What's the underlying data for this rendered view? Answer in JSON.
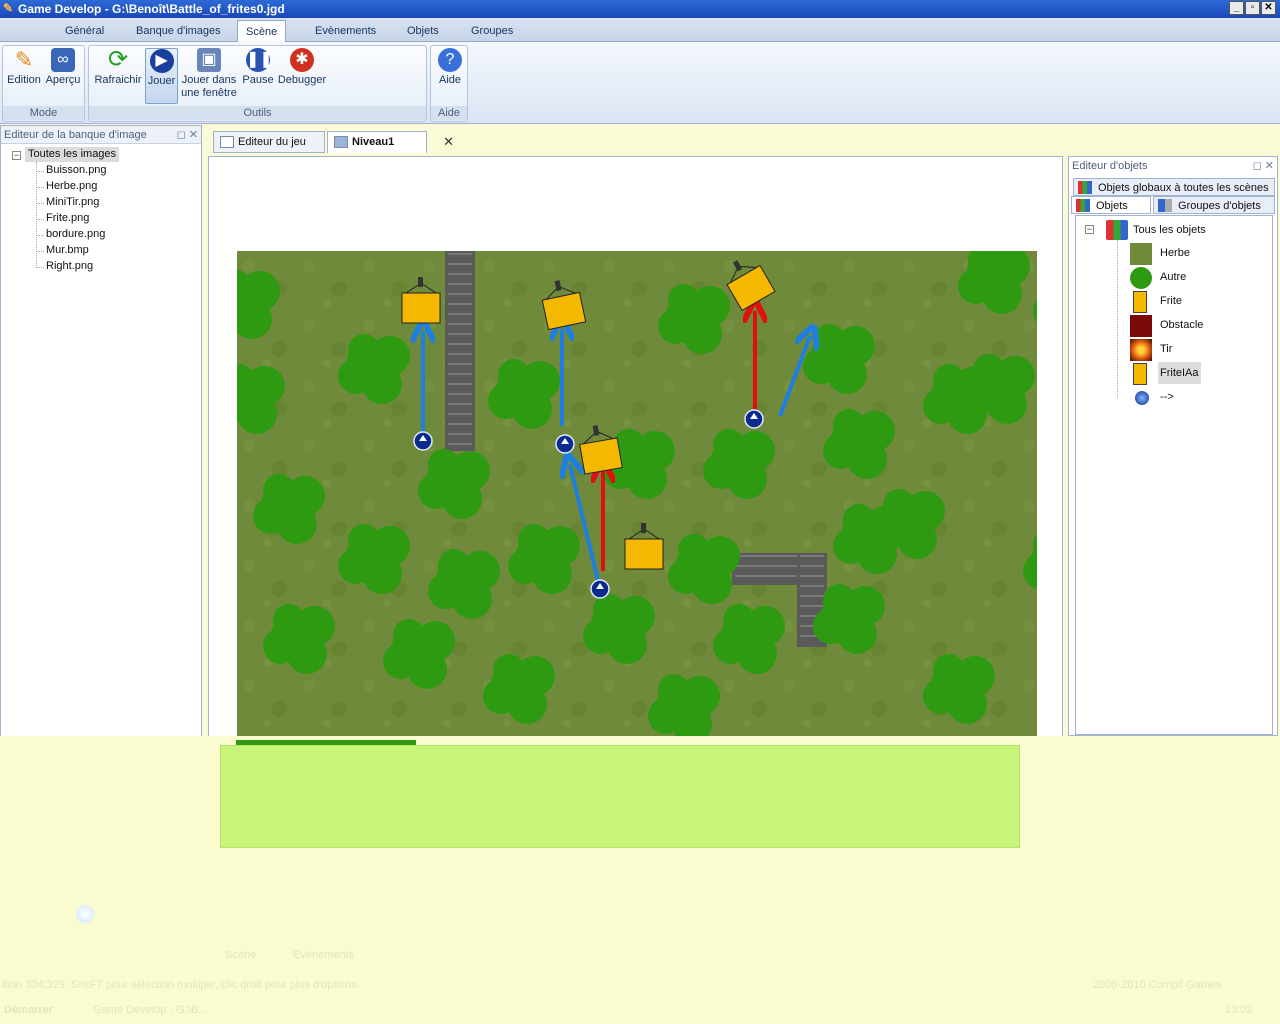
{
  "window": {
    "title": "Game Develop - G:\\Benoît\\Battle_of_frites0.jgd",
    "buttons": [
      "_",
      "▫",
      "✕"
    ]
  },
  "ribbon_tabs": [
    {
      "label": "Général"
    },
    {
      "label": "Banque d'images"
    },
    {
      "label": "Scène",
      "active": true
    },
    {
      "label": "Evènements"
    },
    {
      "label": "Objets"
    },
    {
      "label": "Groupes"
    }
  ],
  "ribbon": {
    "mode": {
      "label": "Mode",
      "edition": "Edition",
      "apercu": "Aperçu"
    },
    "outils": {
      "label": "Outils",
      "rafraichir": "Rafraichir",
      "jouer": "Jouer",
      "jouer_fenetre_1": "Jouer dans",
      "jouer_fenetre_2": "une fenêtre",
      "pause": "Pause",
      "debugger": "Debugger"
    },
    "aide": {
      "label": "Aide",
      "aide": "Aide"
    }
  },
  "image_bank": {
    "title": "Editeur de la banque d'image",
    "root": "Toutes les images",
    "items": [
      "Buisson.png",
      "Herbe.png",
      "MiniTir.png",
      "Frite.png",
      "bordure.png",
      "Mur.bmp",
      "Right.png"
    ]
  },
  "doc_tabs": [
    {
      "label": "Editeur du jeu"
    },
    {
      "label": "Niveau1",
      "active": true
    }
  ],
  "object_editor": {
    "title": "Editeur d'objets",
    "tab_global": "Objets globaux à toutes les scènes",
    "tab_objects": "Objets",
    "tab_groups": "Groupes d'objets",
    "root": "Tous les objets",
    "items": [
      {
        "label": "Herbe",
        "icon": "grass-thumb"
      },
      {
        "label": "Autre",
        "icon": "bush-thumb"
      },
      {
        "label": "Frite",
        "icon": "frite-thumb"
      },
      {
        "label": "Obstacle",
        "icon": "obstacle-thumb"
      },
      {
        "label": "Tir",
        "icon": "tir-thumb"
      },
      {
        "label": "FriteIAa",
        "icon": "frite-thumb",
        "selected": true
      },
      {
        "label": "-->",
        "icon": "arrow-ball-thumb"
      }
    ]
  },
  "faint_text": {
    "tab_scene": "Scène",
    "tab_events": "Evènements",
    "status_left": "ition 334;329. SHIFT pour sélection multiple, clic droit pour plus d'options.",
    "status_right": "2008-2010 Compil Games",
    "taskbar_start": "Démarrer",
    "taskbar_item": "Game Develop - G:\\B...",
    "clock": "13:02"
  },
  "colors": {
    "grass": "#6e8a3a",
    "bush": "#2e9a12",
    "frite": "#f5b800",
    "arrow_blue": "#1e7fe0",
    "arrow_red": "#e01010",
    "glitch_green": "#c6f57a"
  }
}
